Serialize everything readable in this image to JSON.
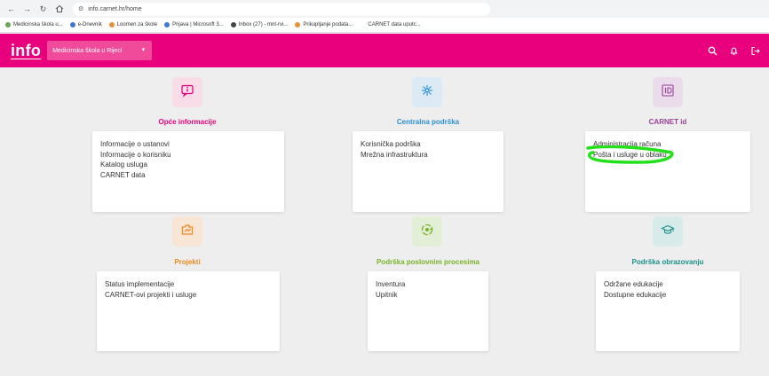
{
  "browser": {
    "url": "info.carnet.hr/home",
    "bookmarks": [
      {
        "label": "Medicinska škola u...",
        "color": "#6aa84f"
      },
      {
        "label": "e-Dnevnik",
        "color": "#3c78d8"
      },
      {
        "label": "Loomen za škole",
        "color": "#e69138"
      },
      {
        "label": "Prijava | Microsoft 3...",
        "color": "#3c78d8"
      },
      {
        "label": "Inbox (27) - mnt-rvi...",
        "color": "#444444"
      },
      {
        "label": "Prikupljanje podata...",
        "color": "#e69138"
      },
      {
        "label": "CARNET data uputc...",
        "color": "#ffffff"
      }
    ]
  },
  "header": {
    "logo": "info",
    "school": "Medicinska škola u Rijeci"
  },
  "sections": [
    {
      "title": "Opće informacije",
      "icon": "info-icon",
      "color": "#e8007c",
      "bg": "#f8dde9",
      "links": [
        "Informacije o ustanovi",
        "Informacije o korisniku",
        "Katalog usluga",
        "CARNET data"
      ]
    },
    {
      "title": "Centralna podrška",
      "icon": "network-icon",
      "color": "#2b8fd6",
      "bg": "#dbeaf5",
      "links": [
        "Korisnička podrška",
        "Mrežna infrastruktura"
      ]
    },
    {
      "title": "CARNET id",
      "icon": "id-card-icon",
      "color": "#9a3f99",
      "bg": "#eadcea",
      "links": [
        "Administracija računa",
        "Pošta i usluge u oblaku"
      ]
    },
    {
      "title": "Projekti",
      "icon": "project-icon",
      "color": "#f0891c",
      "bg": "#f7e6d5",
      "links": [
        "Status implementacije",
        "CARNET-ovi projekti i usluge"
      ]
    },
    {
      "title": "Podrška poslovnim procesima",
      "icon": "process-icon",
      "color": "#78b428",
      "bg": "#e3eed6",
      "links": [
        "Inventura",
        "Upitnik"
      ]
    },
    {
      "title": "Podrška obrazovanju",
      "icon": "graduation-cap-icon",
      "color": "#17908a",
      "bg": "#d7ebea",
      "links": [
        "Održane edukacije",
        "Dostupne edukacije"
      ]
    }
  ]
}
